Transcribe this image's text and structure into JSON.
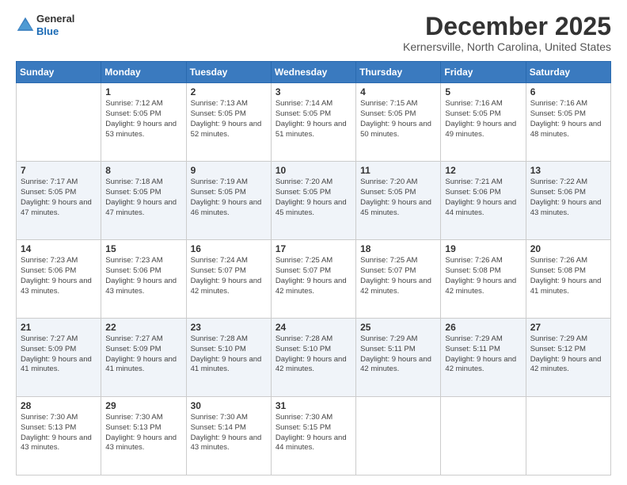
{
  "header": {
    "logo": {
      "general": "General",
      "blue": "Blue"
    },
    "title": "December 2025",
    "location": "Kernersville, North Carolina, United States"
  },
  "days_of_week": [
    "Sunday",
    "Monday",
    "Tuesday",
    "Wednesday",
    "Thursday",
    "Friday",
    "Saturday"
  ],
  "weeks": [
    [
      {
        "day": "",
        "sunrise": "",
        "sunset": "",
        "daylight": ""
      },
      {
        "day": "1",
        "sunrise": "Sunrise: 7:12 AM",
        "sunset": "Sunset: 5:05 PM",
        "daylight": "Daylight: 9 hours and 53 minutes."
      },
      {
        "day": "2",
        "sunrise": "Sunrise: 7:13 AM",
        "sunset": "Sunset: 5:05 PM",
        "daylight": "Daylight: 9 hours and 52 minutes."
      },
      {
        "day": "3",
        "sunrise": "Sunrise: 7:14 AM",
        "sunset": "Sunset: 5:05 PM",
        "daylight": "Daylight: 9 hours and 51 minutes."
      },
      {
        "day": "4",
        "sunrise": "Sunrise: 7:15 AM",
        "sunset": "Sunset: 5:05 PM",
        "daylight": "Daylight: 9 hours and 50 minutes."
      },
      {
        "day": "5",
        "sunrise": "Sunrise: 7:16 AM",
        "sunset": "Sunset: 5:05 PM",
        "daylight": "Daylight: 9 hours and 49 minutes."
      },
      {
        "day": "6",
        "sunrise": "Sunrise: 7:16 AM",
        "sunset": "Sunset: 5:05 PM",
        "daylight": "Daylight: 9 hours and 48 minutes."
      }
    ],
    [
      {
        "day": "7",
        "sunrise": "Sunrise: 7:17 AM",
        "sunset": "Sunset: 5:05 PM",
        "daylight": "Daylight: 9 hours and 47 minutes."
      },
      {
        "day": "8",
        "sunrise": "Sunrise: 7:18 AM",
        "sunset": "Sunset: 5:05 PM",
        "daylight": "Daylight: 9 hours and 47 minutes."
      },
      {
        "day": "9",
        "sunrise": "Sunrise: 7:19 AM",
        "sunset": "Sunset: 5:05 PM",
        "daylight": "Daylight: 9 hours and 46 minutes."
      },
      {
        "day": "10",
        "sunrise": "Sunrise: 7:20 AM",
        "sunset": "Sunset: 5:05 PM",
        "daylight": "Daylight: 9 hours and 45 minutes."
      },
      {
        "day": "11",
        "sunrise": "Sunrise: 7:20 AM",
        "sunset": "Sunset: 5:05 PM",
        "daylight": "Daylight: 9 hours and 45 minutes."
      },
      {
        "day": "12",
        "sunrise": "Sunrise: 7:21 AM",
        "sunset": "Sunset: 5:06 PM",
        "daylight": "Daylight: 9 hours and 44 minutes."
      },
      {
        "day": "13",
        "sunrise": "Sunrise: 7:22 AM",
        "sunset": "Sunset: 5:06 PM",
        "daylight": "Daylight: 9 hours and 43 minutes."
      }
    ],
    [
      {
        "day": "14",
        "sunrise": "Sunrise: 7:23 AM",
        "sunset": "Sunset: 5:06 PM",
        "daylight": "Daylight: 9 hours and 43 minutes."
      },
      {
        "day": "15",
        "sunrise": "Sunrise: 7:23 AM",
        "sunset": "Sunset: 5:06 PM",
        "daylight": "Daylight: 9 hours and 43 minutes."
      },
      {
        "day": "16",
        "sunrise": "Sunrise: 7:24 AM",
        "sunset": "Sunset: 5:07 PM",
        "daylight": "Daylight: 9 hours and 42 minutes."
      },
      {
        "day": "17",
        "sunrise": "Sunrise: 7:25 AM",
        "sunset": "Sunset: 5:07 PM",
        "daylight": "Daylight: 9 hours and 42 minutes."
      },
      {
        "day": "18",
        "sunrise": "Sunrise: 7:25 AM",
        "sunset": "Sunset: 5:07 PM",
        "daylight": "Daylight: 9 hours and 42 minutes."
      },
      {
        "day": "19",
        "sunrise": "Sunrise: 7:26 AM",
        "sunset": "Sunset: 5:08 PM",
        "daylight": "Daylight: 9 hours and 42 minutes."
      },
      {
        "day": "20",
        "sunrise": "Sunrise: 7:26 AM",
        "sunset": "Sunset: 5:08 PM",
        "daylight": "Daylight: 9 hours and 41 minutes."
      }
    ],
    [
      {
        "day": "21",
        "sunrise": "Sunrise: 7:27 AM",
        "sunset": "Sunset: 5:09 PM",
        "daylight": "Daylight: 9 hours and 41 minutes."
      },
      {
        "day": "22",
        "sunrise": "Sunrise: 7:27 AM",
        "sunset": "Sunset: 5:09 PM",
        "daylight": "Daylight: 9 hours and 41 minutes."
      },
      {
        "day": "23",
        "sunrise": "Sunrise: 7:28 AM",
        "sunset": "Sunset: 5:10 PM",
        "daylight": "Daylight: 9 hours and 41 minutes."
      },
      {
        "day": "24",
        "sunrise": "Sunrise: 7:28 AM",
        "sunset": "Sunset: 5:10 PM",
        "daylight": "Daylight: 9 hours and 42 minutes."
      },
      {
        "day": "25",
        "sunrise": "Sunrise: 7:29 AM",
        "sunset": "Sunset: 5:11 PM",
        "daylight": "Daylight: 9 hours and 42 minutes."
      },
      {
        "day": "26",
        "sunrise": "Sunrise: 7:29 AM",
        "sunset": "Sunset: 5:11 PM",
        "daylight": "Daylight: 9 hours and 42 minutes."
      },
      {
        "day": "27",
        "sunrise": "Sunrise: 7:29 AM",
        "sunset": "Sunset: 5:12 PM",
        "daylight": "Daylight: 9 hours and 42 minutes."
      }
    ],
    [
      {
        "day": "28",
        "sunrise": "Sunrise: 7:30 AM",
        "sunset": "Sunset: 5:13 PM",
        "daylight": "Daylight: 9 hours and 43 minutes."
      },
      {
        "day": "29",
        "sunrise": "Sunrise: 7:30 AM",
        "sunset": "Sunset: 5:13 PM",
        "daylight": "Daylight: 9 hours and 43 minutes."
      },
      {
        "day": "30",
        "sunrise": "Sunrise: 7:30 AM",
        "sunset": "Sunset: 5:14 PM",
        "daylight": "Daylight: 9 hours and 43 minutes."
      },
      {
        "day": "31",
        "sunrise": "Sunrise: 7:30 AM",
        "sunset": "Sunset: 5:15 PM",
        "daylight": "Daylight: 9 hours and 44 minutes."
      },
      {
        "day": "",
        "sunrise": "",
        "sunset": "",
        "daylight": ""
      },
      {
        "day": "",
        "sunrise": "",
        "sunset": "",
        "daylight": ""
      },
      {
        "day": "",
        "sunrise": "",
        "sunset": "",
        "daylight": ""
      }
    ]
  ]
}
